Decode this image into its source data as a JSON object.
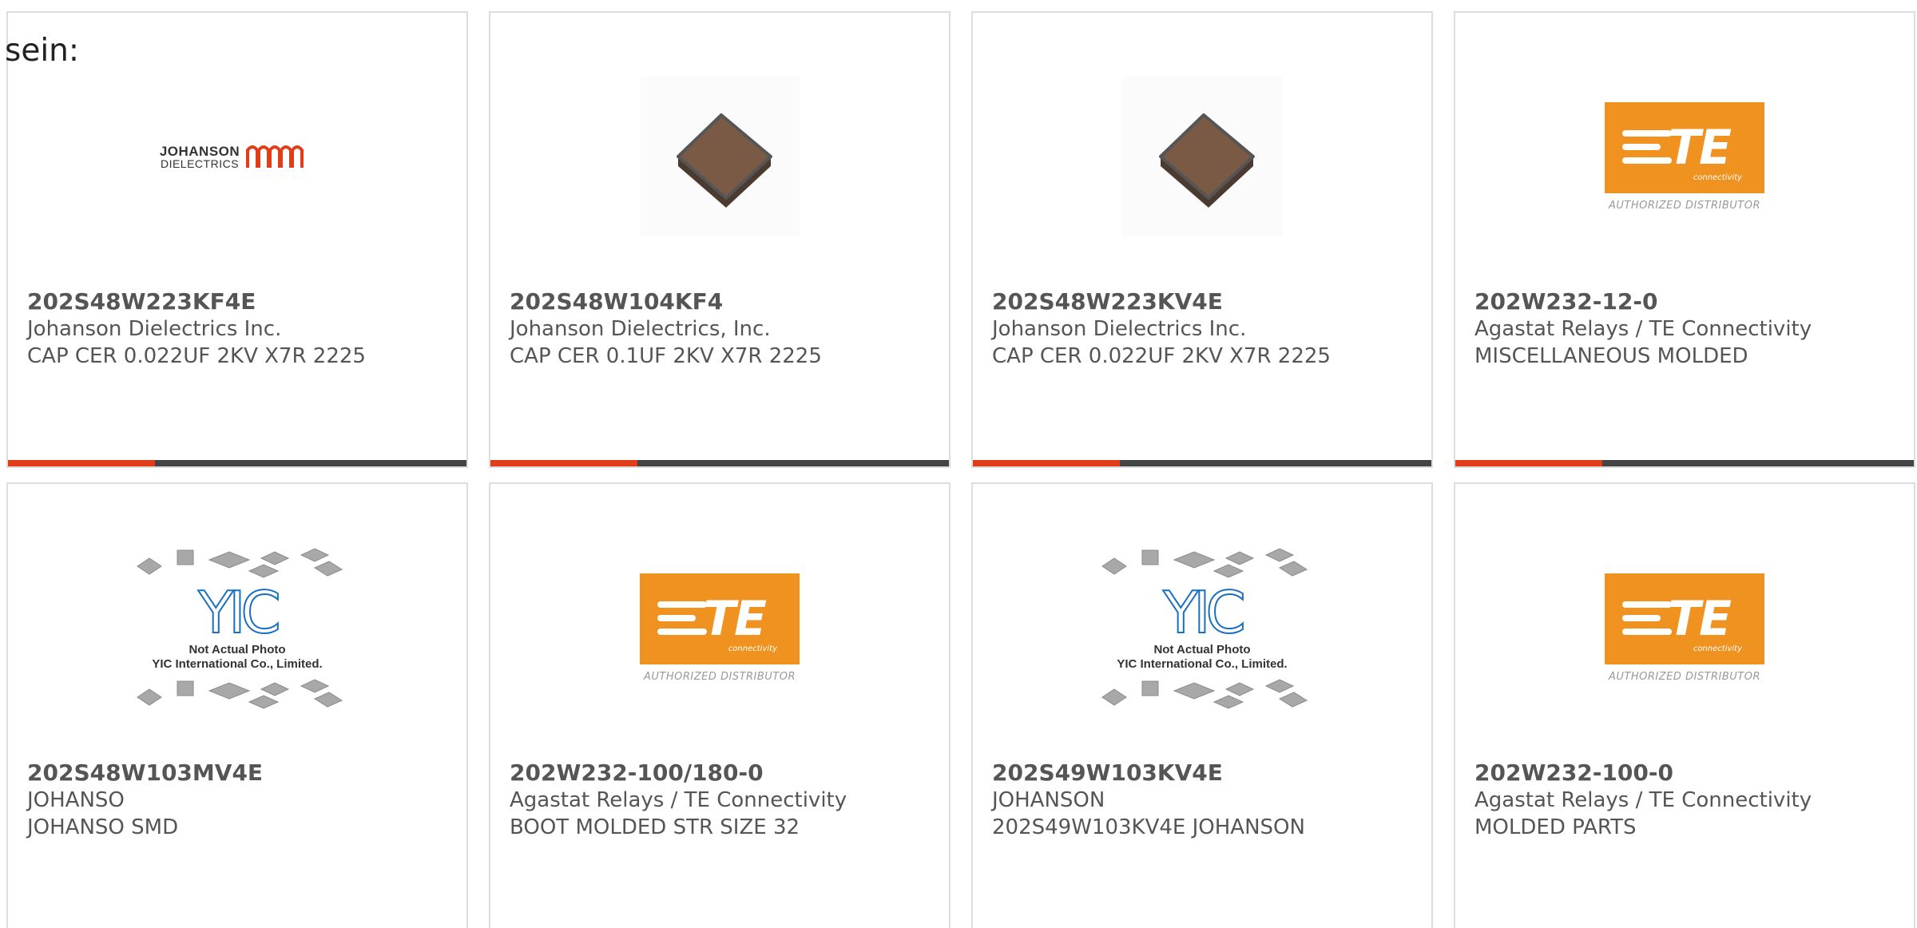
{
  "intro_text": "sein:",
  "colors": {
    "accent_red": "#e03e1a",
    "bar_dark": "#444444",
    "border": "#dddddd",
    "te_orange": "#f0921f",
    "yic_blue": "#1a6fbf",
    "chip_brown": "#7b5a45"
  },
  "logos": {
    "johanson": {
      "line1": "JOHANSON",
      "line2": "DIELECTRICS"
    },
    "te": {
      "letters": "TE",
      "connectivity": "connectivity",
      "authorized": "AUTHORIZED DISTRIBUTOR"
    },
    "yic": {
      "mark": "YIC",
      "line1": "Not Actual Photo",
      "line2": "YIC International Co., Limited."
    }
  },
  "products": [
    {
      "part_number": "202S48W223KF4E",
      "manufacturer": "Johanson Dielectrics Inc.",
      "description": "CAP CER 0.022UF 2KV X7R 2225",
      "image": "johanson-logo",
      "bar_fill": 0.32
    },
    {
      "part_number": "202S48W104KF4",
      "manufacturer": "Johanson Dielectrics, Inc.",
      "description": "CAP CER 0.1UF 2KV X7R 2225",
      "image": "ceramic-chip-photo",
      "bar_fill": 0.32
    },
    {
      "part_number": "202S48W223KV4E",
      "manufacturer": "Johanson Dielectrics Inc.",
      "description": "CAP CER 0.022UF 2KV X7R 2225",
      "image": "ceramic-chip-photo",
      "bar_fill": 0.32
    },
    {
      "part_number": "202W232-12-0",
      "manufacturer": "Agastat Relays / TE Connectivity",
      "description": "MISCELLANEOUS MOLDED",
      "image": "te-connectivity-logo",
      "bar_fill": 0.32
    },
    {
      "part_number": "202S48W103MV4E",
      "manufacturer": "JOHANSO",
      "description": "JOHANSO SMD",
      "image": "yic-placeholder"
    },
    {
      "part_number": "202W232-100/180-0",
      "manufacturer": "Agastat Relays / TE Connectivity",
      "description": "BOOT MOLDED STR SIZE 32",
      "image": "te-connectivity-logo"
    },
    {
      "part_number": "202S49W103KV4E",
      "manufacturer": "JOHANSON",
      "description": "202S49W103KV4E JOHANSON",
      "image": "yic-placeholder"
    },
    {
      "part_number": "202W232-100-0",
      "manufacturer": "Agastat Relays / TE Connectivity",
      "description": "MOLDED PARTS",
      "image": "te-connectivity-logo"
    }
  ]
}
